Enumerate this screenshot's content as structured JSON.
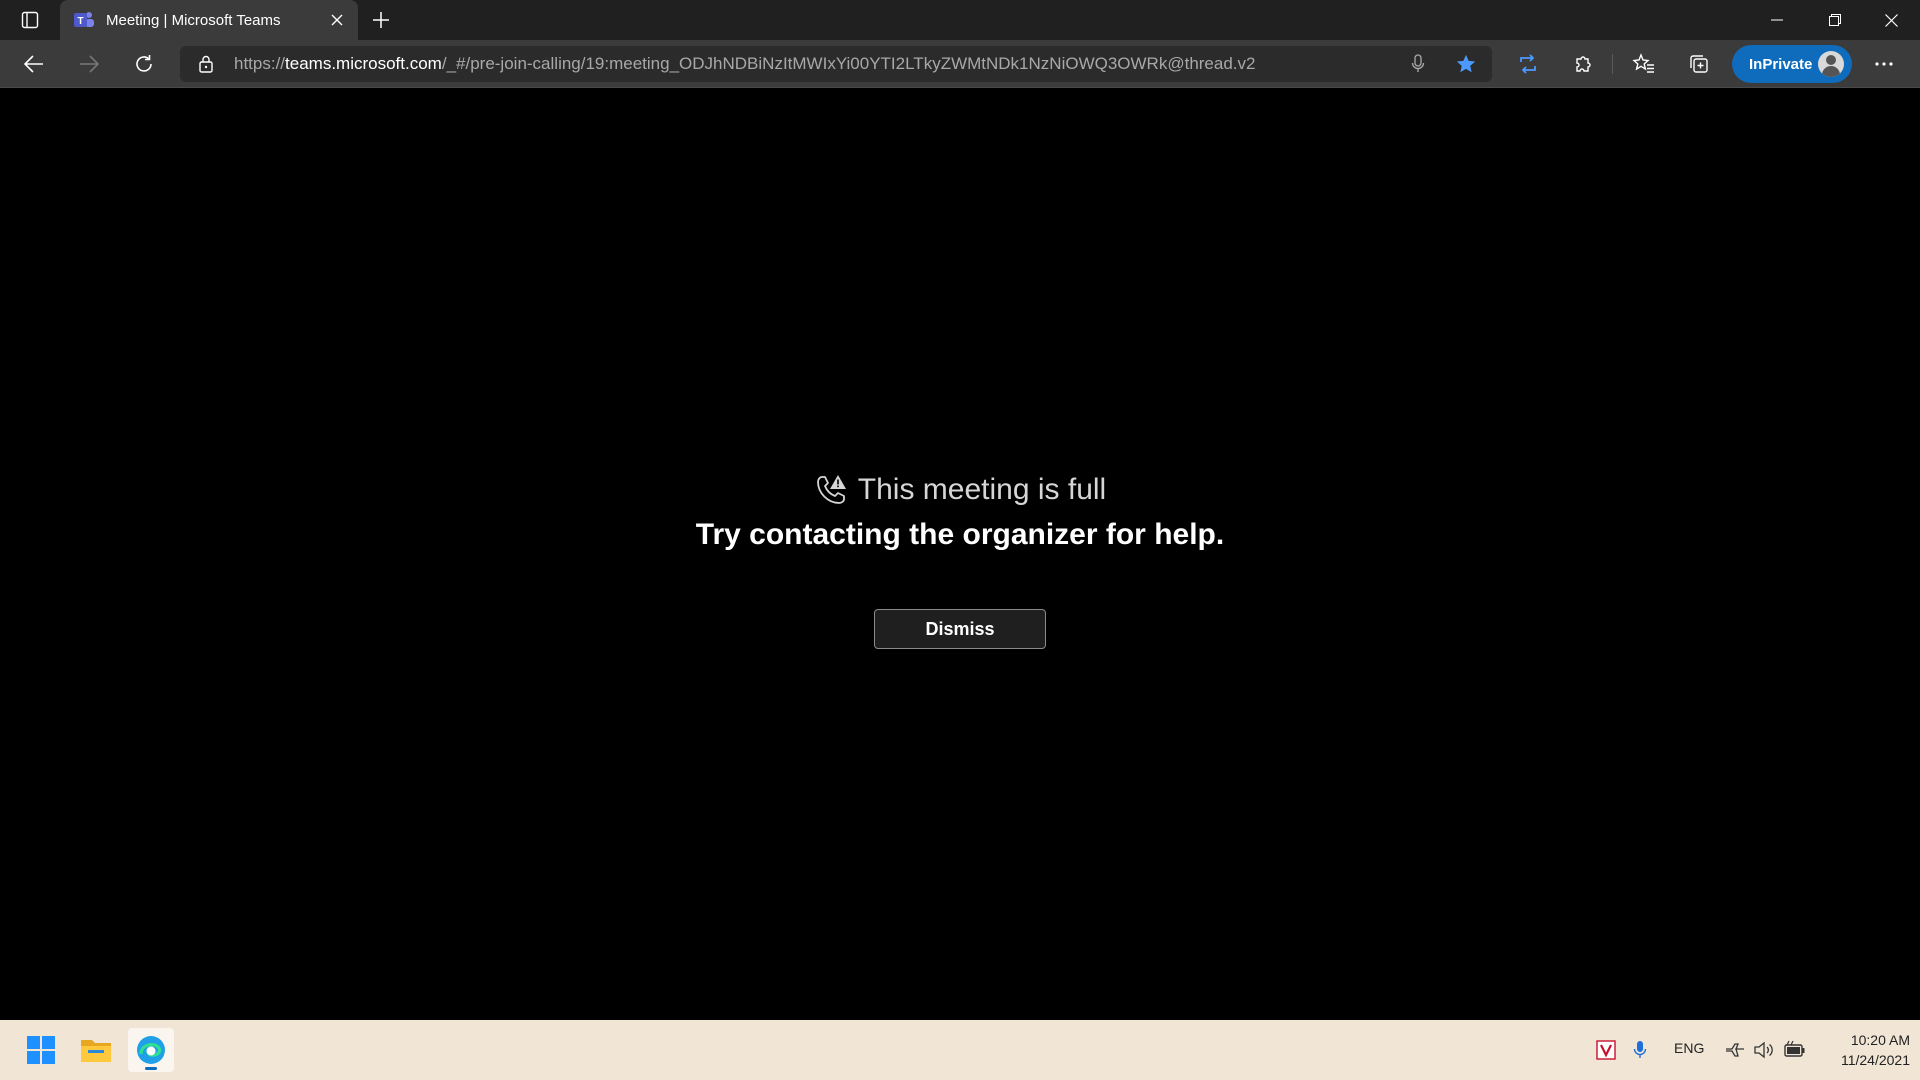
{
  "browser": {
    "tab": {
      "title": "Meeting | Microsoft Teams"
    },
    "address": {
      "prefix": "https://",
      "host": "teams.microsoft.com",
      "path": "/_#/pre-join-calling/19:meeting_ODJhNDBiNzItMWIxYi00YTI2LTkyZWMtNDk1NzNiOWQ3OWRk@thread.v2"
    },
    "inprivate_label": "InPrivate",
    "accent_color": "#0f6cbd"
  },
  "message": {
    "icon": "call-warning-icon",
    "title": "This meeting is full",
    "subtitle": "Try contacting the organizer for help.",
    "dismiss_label": "Dismiss"
  },
  "taskbar": {
    "apps": [
      "windows-start-icon",
      "file-explorer-icon",
      "edge-icon"
    ],
    "tray": {
      "language": "ENG",
      "time": "10:20 AM",
      "date": "11/24/2021"
    }
  }
}
